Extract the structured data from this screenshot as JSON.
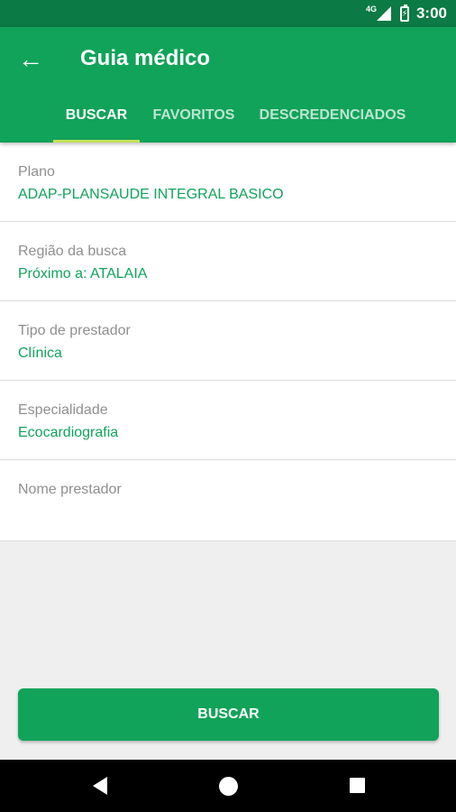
{
  "status_bar": {
    "network": "4G",
    "time": "3:00",
    "icons": [
      "signal-icon",
      "battery-charging-icon"
    ]
  },
  "app_bar": {
    "title": "Guia médico",
    "back_icon": "arrow-left-icon"
  },
  "tabs": [
    {
      "label": "BUSCAR",
      "active": true
    },
    {
      "label": "FAVORITOS",
      "active": false
    },
    {
      "label": "DESCREDENCIADOS",
      "active": false
    }
  ],
  "form": {
    "fields": [
      {
        "label": "Plano",
        "value": "ADAP-PLANSAUDE INTEGRAL BASICO"
      },
      {
        "label": "Região da busca",
        "value": "Próximo a: ATALAIA"
      },
      {
        "label": "Tipo de prestador",
        "value": "Clínica"
      },
      {
        "label": "Especialidade",
        "value": "Ecocardiografia"
      },
      {
        "label": "Nome prestador",
        "value": ""
      }
    ]
  },
  "search_button_label": "BUSCAR",
  "colors": {
    "status_bar": "#0b7a44",
    "primary": "#11a35a",
    "tab_indicator": "#c6df5a",
    "label_gray": "#8f8f8f",
    "background": "#efefef"
  },
  "nav_bar_icons": [
    "nav-back-icon",
    "nav-home-icon",
    "nav-recent-apps-icon"
  ]
}
